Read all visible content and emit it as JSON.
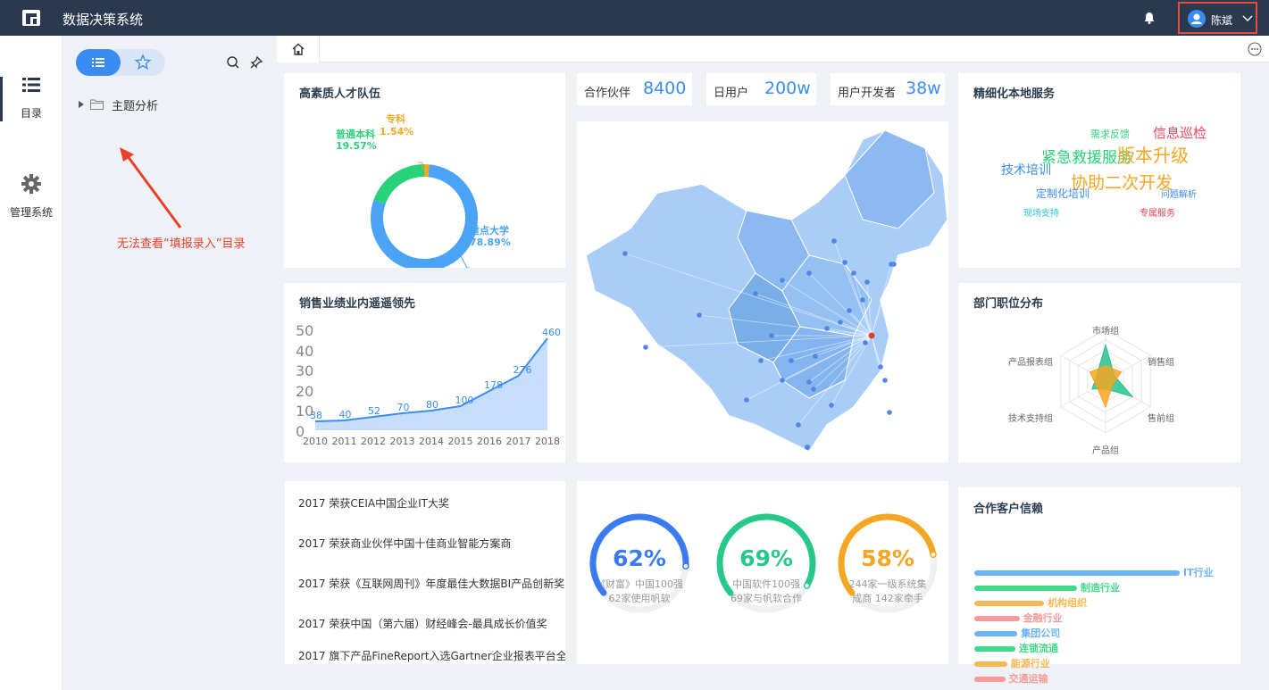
{
  "app": {
    "title": "数据决策系统",
    "user": "陈斌"
  },
  "nav": [
    {
      "label": "目录",
      "icon": "list-icon"
    },
    {
      "label": "管理系统",
      "icon": "gear-icon"
    }
  ],
  "tree": {
    "item": "主题分析"
  },
  "annotation": "无法查看“填报录入”目录",
  "talent": {
    "title": "高素质人才队伍",
    "chart_data": {
      "type": "pie",
      "donut": true,
      "categories": [
        "重点大学",
        "普通本科",
        "专科"
      ],
      "values": [
        78.89,
        19.57,
        1.54
      ],
      "labels": [
        "78.89%",
        "19.57%",
        "1.54%"
      ],
      "colors": [
        "#4aa3f5",
        "#28d27a",
        "#f5a623"
      ]
    }
  },
  "stats": [
    {
      "label": "合作伙伴",
      "value": "8400"
    },
    {
      "label": "日用户",
      "value": "200w"
    },
    {
      "label": "用户开发者",
      "value": "38w"
    }
  ],
  "sales": {
    "title": "销售业绩业内遥遥领先",
    "chart_data": {
      "type": "area",
      "x": [
        "2010",
        "2011",
        "2012",
        "2013",
        "2014",
        "2015",
        "2016",
        "2017",
        "2018"
      ],
      "values": [
        38,
        40,
        52,
        70,
        80,
        100,
        178,
        276,
        460
      ],
      "yticks": [
        "0",
        "10",
        "20",
        "30",
        "40",
        "50"
      ],
      "color": "#3b8cf2"
    }
  },
  "services": {
    "title": "精细化本地服务",
    "words": [
      {
        "text": "需求反馈",
        "color": "#28d27a"
      },
      {
        "text": "信息巡检",
        "color": "#f0445b"
      },
      {
        "text": "紧急救援服务",
        "color": "#28d27a"
      },
      {
        "text": "版本升级",
        "color": "#f5a623"
      },
      {
        "text": "技术培训",
        "color": "#3b8cf2"
      },
      {
        "text": "协助二次开发",
        "color": "#f5a623"
      },
      {
        "text": "定制化培训",
        "color": "#3b8cf2"
      },
      {
        "text": "问题解析",
        "color": "#3b8cf2"
      },
      {
        "text": "现场支持",
        "color": "#22c3e6"
      },
      {
        "text": "专属服务",
        "color": "#f0445b"
      }
    ]
  },
  "dept": {
    "title": "部门职位分布",
    "chart_data": {
      "type": "radar",
      "axes": [
        "市场组",
        "销售组",
        "售前组",
        "产品组",
        "技术支持组",
        "产品报表组"
      ],
      "series": [
        {
          "values": [
            0.7,
            0.2,
            0.6,
            0.15,
            0.3,
            0.2
          ],
          "color": "#28c28f"
        },
        {
          "values": [
            0.3,
            0.35,
            0.15,
            0.5,
            0.2,
            0.35
          ],
          "color": "#f5a623"
        }
      ]
    }
  },
  "awards": [
    "2017 荣获CEIA中国企业IT大奖",
    "2017 荣获商业伙伴中国十佳商业智能方案商",
    "2017 荣获《互联网周刊》年度最佳大数据BI产品创新奖",
    "2017 荣获中国（第六届）财经峰会-最具成长价值奖",
    "2017 旗下产品FineReport入选Gartner企业报表平台全"
  ],
  "gauges": [
    {
      "pct": "62%",
      "value": 62,
      "line1": "《财富》中国100强",
      "line2": "62家使用帆软",
      "color": "#3b7bf2"
    },
    {
      "pct": "69%",
      "value": 69,
      "line1": "中国软件100强",
      "line2": "69家与帆软合作",
      "color": "#26c98a"
    },
    {
      "pct": "58%",
      "value": 58,
      "line1": "244家一级系统集",
      "line2": "成商 142家牵手",
      "color": "#f5a623"
    }
  ],
  "clients": {
    "title": "合作客户信赖",
    "bars": [
      {
        "label": "IT行业",
        "value": 100,
        "color": "#6cb4f5"
      },
      {
        "label": "制造行业",
        "value": 50,
        "color": "#41d98a"
      },
      {
        "label": "机构组织",
        "value": 34,
        "color": "#f7b955"
      },
      {
        "label": "金融行业",
        "value": 22,
        "color": "#f79a9a"
      },
      {
        "label": "集团公司",
        "value": 21,
        "color": "#6cb4f5"
      },
      {
        "label": "连锁流通",
        "value": 20,
        "color": "#41d98a"
      },
      {
        "label": "能源行业",
        "value": 16,
        "color": "#f7b955"
      },
      {
        "label": "交通运输",
        "value": 15,
        "color": "#f79a9a"
      }
    ]
  }
}
